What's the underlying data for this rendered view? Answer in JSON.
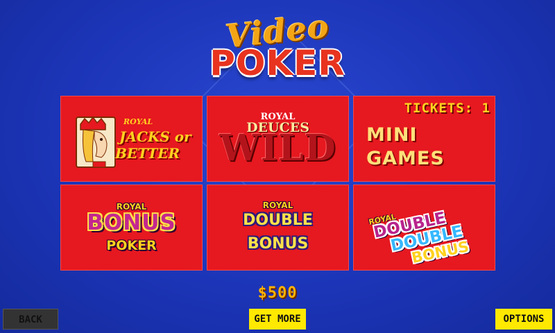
{
  "logo": {
    "video": "Video",
    "poker": "POKER"
  },
  "games": [
    {
      "royal": "ROYAL",
      "line1": "JACKS or",
      "line2": "BETTER"
    },
    {
      "royal": "ROYAL",
      "line1": "DEUCES",
      "line2": "WILD"
    },
    {
      "tickets_label": "TICKETS: 1",
      "line1": "MINI",
      "line2": "GAMES"
    },
    {
      "royal": "ROYAL",
      "line1": "BONUS",
      "line2": "POKER"
    },
    {
      "royal": "ROYAL",
      "line1": "DOUBLE",
      "line2": "BONUS"
    },
    {
      "royal": "ROYAL",
      "line1": "DOUBLE",
      "line2": "DOUBLE",
      "line3": "BONUS"
    }
  ],
  "balance": "$500",
  "buttons": {
    "back": "BACK",
    "get_more": "GET MORE",
    "options": "OPTIONS"
  },
  "colors": {
    "background": "#1c35b8",
    "tile": "#e61820",
    "accent_yellow": "#ffe900"
  },
  "icons": {
    "jack_card": "jack-card-icon"
  }
}
